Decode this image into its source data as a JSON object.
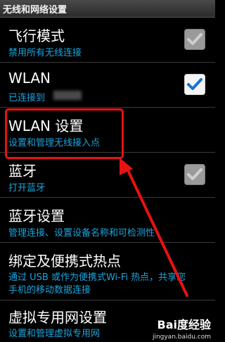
{
  "header": {
    "title": "无线和网络设置"
  },
  "items": [
    {
      "title": "飞行模式",
      "subtitle": "禁用所有无线连接",
      "checked": true,
      "enabled": false
    },
    {
      "title": "WLAN",
      "subtitle": "已连接到",
      "checked": true,
      "enabled": true
    },
    {
      "title": "WLAN 设置",
      "subtitle": "设置和管理无线接入点"
    },
    {
      "title": "蓝牙",
      "subtitle": "打开蓝牙",
      "checked": true,
      "enabled": false
    },
    {
      "title": "蓝牙设置",
      "subtitle": "管理连接、设置设备名称和可检测性"
    },
    {
      "title": "绑定及便携式热点",
      "subtitle": "通过 USB 或作为便携式Wi-Fi 热点，共享您",
      "subtitle2": "手机的移动数据连接"
    },
    {
      "title": "虚拟专用网设置",
      "subtitle": "设置和管理虚拟专用网"
    }
  ],
  "colors": {
    "accent": "#1aa5e0",
    "highlight": "#e81212",
    "check": "#1b6fd6"
  },
  "watermark": {
    "logo": "Bai度经验",
    "url": "jingyan.baidu.com"
  }
}
